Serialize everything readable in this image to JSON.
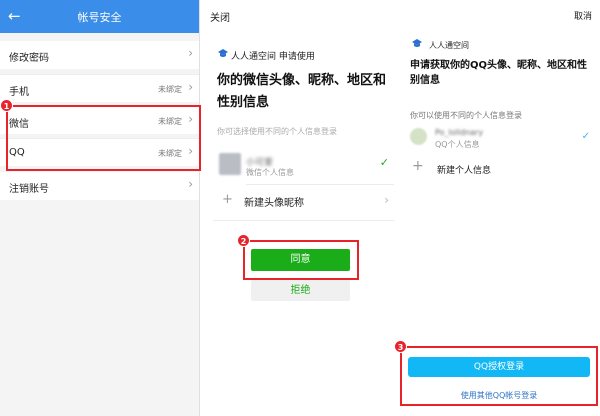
{
  "left": {
    "title": "帐号安全",
    "back_icon": "arrow-left-icon",
    "rows": [
      {
        "label": "修改密码",
        "value": ""
      },
      {
        "label": "手机",
        "value": "未绑定"
      },
      {
        "label": "微信",
        "value": "未绑定"
      },
      {
        "label": "QQ",
        "value": "未绑定"
      },
      {
        "label": "注销账号",
        "value": ""
      }
    ]
  },
  "middle": {
    "close_label": "关闭",
    "app_line": "人人通空间   申请使用",
    "title": "你的微信头像、昵称、地区和性别信息",
    "hint": "你可选择使用不同的个人信息登录",
    "profile_name": "小可爱",
    "profile_sub": "微信个人信息",
    "new_profile_label": "新建头像昵称",
    "agree_label": "同意",
    "reject_label": "拒绝"
  },
  "right": {
    "cancel_label": "取消",
    "app_name": "人人通空间",
    "title": "申请获取你的QQ头像、昵称、地区和性别信息",
    "hint": "你可以使用不同的个人信息登录",
    "profile_name": "Po_lolldnary",
    "profile_sub": "QQ个人信息",
    "new_profile_label": "新建个人信息",
    "authorize_label": "QQ授权登录",
    "other_account_label": "使用其他QQ帐号登录"
  },
  "steps": [
    "1",
    "2",
    "3"
  ],
  "colors": {
    "header_blue": "#3a8de8",
    "wechat_green": "#1aad19",
    "qq_blue": "#12b7f5",
    "highlight_red": "#e8232a"
  }
}
